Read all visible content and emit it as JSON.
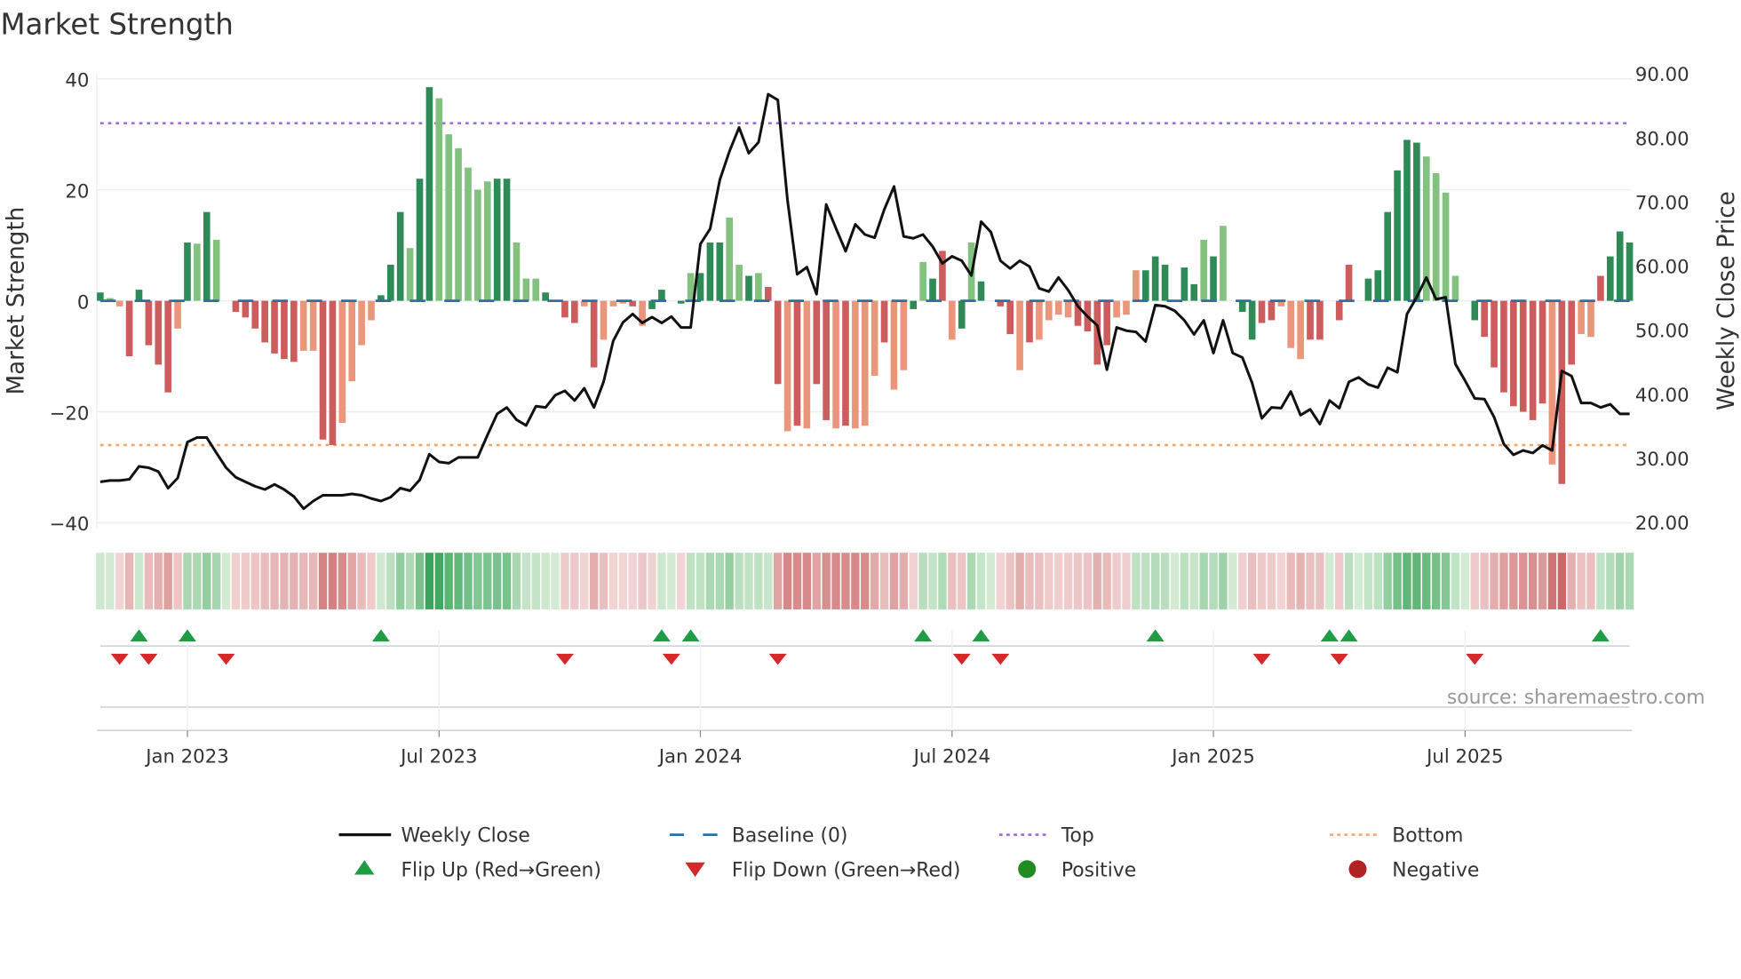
{
  "chart_data": {
    "type": "bar",
    "title": "Market Strength",
    "ylabel": "Market Strength",
    "y2label": "Weekly Close Price",
    "ylim": [
      -40,
      40
    ],
    "y2lim": [
      20,
      90
    ],
    "yticks": [
      "40",
      "20",
      "0",
      "−20",
      "−40"
    ],
    "ytick_values": [
      40,
      20,
      0,
      -20,
      -40
    ],
    "y2ticks": [
      "90.00",
      "80.00",
      "70.00",
      "60.00",
      "50.00",
      "40.00",
      "30.00",
      "20.00"
    ],
    "y2tick_values": [
      90,
      80,
      70,
      60,
      50,
      40,
      30,
      20
    ],
    "x_unit": "week index",
    "xticks": [
      {
        "label": "Jan 2023",
        "week": 9
      },
      {
        "label": "Jul 2023",
        "week": 35
      },
      {
        "label": "Jan 2024",
        "week": 62
      },
      {
        "label": "Jul 2024",
        "week": 88
      },
      {
        "label": "Jan 2025",
        "week": 115
      },
      {
        "label": "Jul 2025",
        "week": 141
      }
    ],
    "top_level": 32,
    "bottom_level": -26,
    "strength": [
      1.5,
      0.5,
      -1,
      -10,
      2,
      -8,
      -11.5,
      -16.5,
      -5,
      10.5,
      10.3,
      16,
      11,
      0,
      -2,
      -3,
      -5,
      -7.5,
      -9.5,
      -10.5,
      -11,
      -9,
      -9,
      -25,
      -26,
      -22,
      -14.5,
      -8,
      -3.5,
      1,
      6.5,
      16,
      9.5,
      22,
      38.5,
      36.5,
      30,
      27.5,
      24,
      20,
      21.5,
      22,
      22,
      10.5,
      4,
      4,
      1.5,
      0,
      -3,
      -4,
      -1,
      -12,
      -7,
      -1,
      -0.5,
      -1,
      -4.5,
      -1.5,
      2,
      0,
      -0.5,
      5,
      5,
      10.5,
      10.5,
      15,
      6.5,
      4.5,
      5,
      2.5,
      -15,
      -23.5,
      -22.5,
      -23,
      -15,
      -21.5,
      -23,
      -22.5,
      -23,
      -22.5,
      -13.5,
      -7.5,
      -16,
      -12.5,
      -1.5,
      7,
      4,
      9,
      -7,
      -5,
      10.5,
      3.5,
      0,
      -1,
      -6,
      -12.5,
      -7.5,
      -7,
      -3.5,
      -2.5,
      -3,
      -4.5,
      -5.5,
      -11.5,
      -8,
      -3,
      -2.5,
      5.5,
      5.5,
      8,
      6.5,
      0,
      6,
      3,
      11,
      8,
      13.5,
      0,
      -2,
      -7,
      -4,
      -3.5,
      -1,
      -8.5,
      -10.5,
      -7,
      -7,
      0,
      -3.5,
      6.5,
      0,
      4,
      5.5,
      16,
      23.5,
      29,
      28.5,
      26,
      23,
      19.5,
      4.5,
      0,
      -3.5,
      -6.5,
      -12,
      -16.5,
      -19,
      -20,
      -21.5,
      -18.5,
      -29.5,
      -33,
      -11.5,
      -6,
      -6.5,
      4.5,
      8,
      12.5,
      10.5
    ],
    "strength_shade": "GgrRGRRRrGgGgGRRRRRRRrrRRrrrrGGGgGGggggggGGgggGGRRrRrrrRrGGrGgGGGggGgRRrRrRRrRrrrRrrGgGRrGgGRRRrRrrrrRRRRrrrGGGgGGgGgGGGRRrrrRRrRRRGGGGGGgggggGRRRRRRRrRRrrRGGGg",
    "weekly_close": [
      26.4,
      26.6,
      26.6,
      26.8,
      28.8,
      28.6,
      28,
      25.4,
      27,
      32.6,
      33.3,
      33.3,
      30.9,
      28.6,
      27.1,
      26.4,
      25.7,
      25.2,
      26,
      25.2,
      24.1,
      22.2,
      23.4,
      24.3,
      24.3,
      24.3,
      24.5,
      24.3,
      23.8,
      23.4,
      24,
      25.4,
      25,
      26.7,
      30.7,
      29.5,
      29.3,
      30.2,
      30.2,
      30.2,
      33.7,
      37,
      38,
      36.1,
      35.2,
      38.2,
      38,
      39.9,
      40.6,
      39.1,
      41,
      38,
      42,
      48.4,
      51.3,
      52.6,
      51.2,
      52.1,
      51.2,
      52.2,
      50.5,
      50.5,
      63.5,
      65.9,
      73.5,
      78,
      81.7,
      77.7,
      79.4,
      86.9,
      86,
      70.4,
      58.8,
      59.9,
      55.7,
      69.7,
      66,
      62.4,
      66.6,
      65,
      64.5,
      68.9,
      72.5,
      64.7,
      64.4,
      65,
      63.1,
      60.5,
      61.6,
      60.9,
      58.6,
      67,
      65.4,
      60.9,
      59.7,
      60.9,
      60,
      56.6,
      56.1,
      58.3,
      56.3,
      53.8,
      52.2,
      50.8,
      43.9,
      50.5,
      50,
      49.8,
      48.3,
      54,
      53.8,
      53.1,
      51.6,
      49.4,
      51.6,
      46.5,
      51.6,
      46.5,
      45.8,
      41.8,
      36.3,
      38,
      37.9,
      40.5,
      36.8,
      37.7,
      35.4,
      39.1,
      37.9,
      42,
      42.7,
      41.6,
      41.1,
      44.2,
      43.5,
      52.6,
      55.2,
      58.3,
      54.9,
      55.2,
      44.8,
      42.2,
      39.4,
      39.3,
      36.5,
      32.3,
      30.6,
      31.3,
      30.9,
      32.1,
      31.3,
      43.7,
      42.9,
      38.7,
      38.7,
      38,
      38.5,
      37,
      37
    ],
    "flip_up_weeks": [
      4,
      9,
      29,
      58,
      61,
      85,
      91,
      109,
      127,
      129,
      155
    ],
    "flip_down_weeks": [
      2,
      5,
      13,
      48,
      59,
      70,
      89,
      93,
      120,
      128,
      142
    ],
    "legend": {
      "position": "bottom",
      "items": [
        {
          "label": "Weekly Close",
          "symbol": "line",
          "color": "#111111"
        },
        {
          "label": "Baseline (0)",
          "symbol": "dashed",
          "color": "#2f6f9f"
        },
        {
          "label": "Top",
          "symbol": "dotted",
          "color": "#9b5de5"
        },
        {
          "label": "Bottom",
          "symbol": "dotted",
          "color": "#f4a261"
        },
        {
          "label": "Flip Up (Red→Green)",
          "symbol": "triangle-up",
          "color": "#1f9d45"
        },
        {
          "label": "Flip Down (Green→Red)",
          "symbol": "triangle-down",
          "color": "#d62828"
        },
        {
          "label": "Positive",
          "symbol": "circle",
          "color": "#228b22"
        },
        {
          "label": "Negative",
          "symbol": "circle",
          "color": "#b22222"
        }
      ]
    },
    "colors": {
      "G": "#2e8b57",
      "g": "#82c17e",
      "R": "#cd5c5c",
      "r": "#e9967a",
      "top": "#9b5de5",
      "bottom": "#f4a261",
      "baseline": "#2f6f9f",
      "line": "#111111",
      "flip_up": "#1f9d45",
      "flip_down": "#d62828"
    }
  },
  "source": "source: sharemaestro.com"
}
